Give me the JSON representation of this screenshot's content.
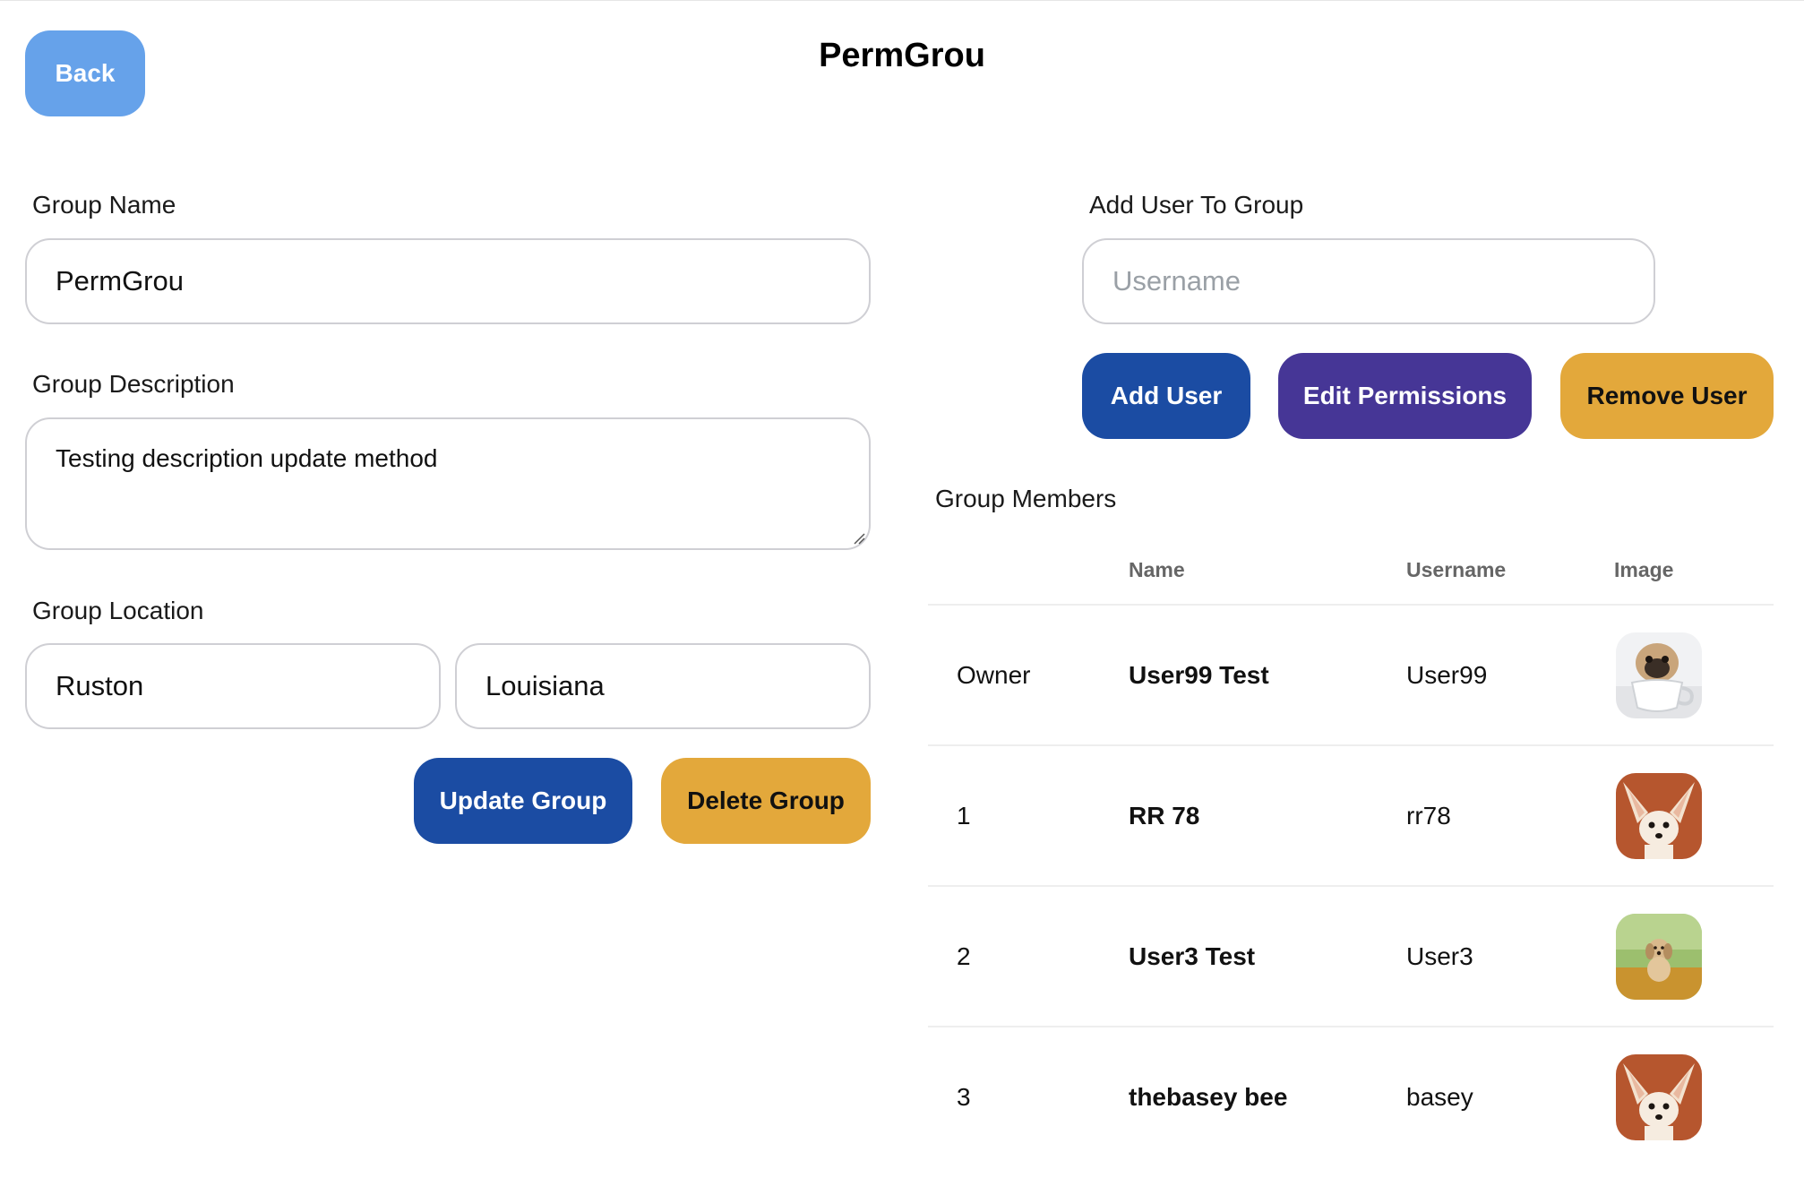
{
  "header": {
    "back_label": "Back",
    "title": "PermGrou"
  },
  "form": {
    "group_name_label": "Group Name",
    "group_name_value": "PermGrou",
    "group_description_label": "Group Description",
    "group_description_value": "Testing description update method",
    "group_location_label": "Group Location",
    "city_value": "Ruston",
    "state_value": "Louisiana",
    "update_label": "Update Group",
    "delete_label": "Delete Group"
  },
  "add_user": {
    "label": "Add User To Group",
    "username_placeholder": "Username",
    "add_label": "Add User",
    "edit_label": "Edit Permissions",
    "remove_label": "Remove User"
  },
  "members": {
    "heading": "Group Members",
    "columns": {
      "name": "Name",
      "username": "Username",
      "image": "Image"
    },
    "rows": [
      {
        "rank": "Owner",
        "name": "User99 Test",
        "username": "User99",
        "image": "pug-in-teacup"
      },
      {
        "rank": "1",
        "name": "RR 78",
        "username": "rr78",
        "image": "fennec-fox"
      },
      {
        "rank": "2",
        "name": "User3 Test",
        "username": "User3",
        "image": "puppy-in-grass"
      },
      {
        "rank": "3",
        "name": "thebasey bee",
        "username": "basey",
        "image": "fennec-fox"
      }
    ]
  },
  "colors": {
    "back": "#66a2ea",
    "primary": "#1b4ca3",
    "permissions": "#463696",
    "warning": "#e3a83b"
  }
}
